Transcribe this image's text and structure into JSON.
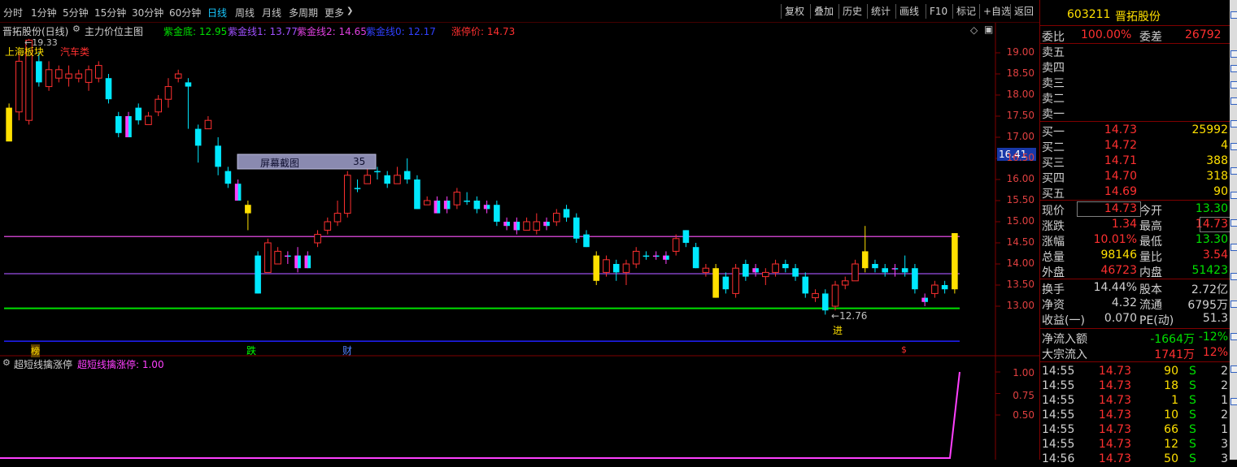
{
  "toolbar": {
    "tabs": [
      "分时",
      "1分钟",
      "5分钟",
      "15分钟",
      "30分钟",
      "60分钟",
      "日线",
      "周线",
      "月线",
      "多周期",
      "更多"
    ],
    "active_tab": "日线",
    "more_arrow": "❯",
    "right_buttons": [
      "复权",
      "叠加",
      "历史",
      "统计",
      "画线",
      "F10",
      "标记",
      "+自选",
      "返回"
    ]
  },
  "chart": {
    "title": "晋拓股份(日线)",
    "indicator_name": "主力价位主图",
    "legend": {
      "zj_di": "紫金底: 12.95",
      "zj1": "紫金线1: 13.77",
      "zj2": "紫金线2: 14.65",
      "zj0": "紫金线0: 12.17",
      "zt": "涨停价: 14.73"
    },
    "labels": {
      "sector": "上海板块",
      "industry": "汽车类",
      "high_mark": "19.33",
      "low_mark": "12.76",
      "jin": "进",
      "screenshot_box": "屏幕截图",
      "screenshot_num": "35",
      "current_price_tag": "16.41"
    },
    "events": [
      "榜",
      "跌",
      "财",
      "$"
    ],
    "price_axis": [
      "19.00",
      "18.50",
      "18.00",
      "17.50",
      "17.00",
      "16.50",
      "16.00",
      "15.50",
      "15.00",
      "14.50",
      "14.00",
      "13.50",
      "13.00"
    ],
    "sub": {
      "name": "超短线擒涨停",
      "value_label": "超短线擒涨停: 1.00",
      "axis": [
        "1.00",
        "0.75",
        "0.50"
      ]
    },
    "colors": {
      "up": "#ff3030",
      "down": "#00e8ff",
      "zj2": "#c040c0",
      "zj1": "#8040c0",
      "zjdi": "#00e000",
      "zj0": "#2020ff",
      "yellow": "#ffe000",
      "magenta": "#ff40ff"
    }
  },
  "chart_data": {
    "type": "candlestick",
    "ylim": [
      12.5,
      19.5
    ],
    "hlines": {
      "紫金线2": 14.65,
      "紫金线1": 13.77,
      "紫金底": 12.95,
      "紫金线0": 12.17
    },
    "candles": [
      [
        16.9,
        17.7,
        17.0,
        17.8,
        "y"
      ],
      [
        17.6,
        18.8,
        17.4,
        19.0,
        "u"
      ],
      [
        17.4,
        19.3,
        17.3,
        19.33,
        "u"
      ],
      [
        18.8,
        18.3,
        18.2,
        19.0,
        "d"
      ],
      [
        18.2,
        18.6,
        18.1,
        18.8,
        "u"
      ],
      [
        18.4,
        18.6,
        18.3,
        18.7,
        "u"
      ],
      [
        18.4,
        18.5,
        18.2,
        18.7,
        "u"
      ],
      [
        18.5,
        18.4,
        18.3,
        18.6,
        "u"
      ],
      [
        18.6,
        18.3,
        18.1,
        18.7,
        "u"
      ],
      [
        18.4,
        18.7,
        18.3,
        18.8,
        "u"
      ],
      [
        18.4,
        17.9,
        17.8,
        18.5,
        "d"
      ],
      [
        17.5,
        17.1,
        17.0,
        17.6,
        "d"
      ],
      [
        17.5,
        17.0,
        17.0,
        17.6,
        "m"
      ],
      [
        17.7,
        17.4,
        17.3,
        17.8,
        "d"
      ],
      [
        17.3,
        17.5,
        17.3,
        17.6,
        "u"
      ],
      [
        17.6,
        17.9,
        17.5,
        18.0,
        "u"
      ],
      [
        18.2,
        17.9,
        17.7,
        18.4,
        "u"
      ],
      [
        18.4,
        18.5,
        18.3,
        18.6,
        "u"
      ],
      [
        18.3,
        18.2,
        17.2,
        18.4,
        "d"
      ],
      [
        17.2,
        16.8,
        16.4,
        17.3,
        "d"
      ],
      [
        17.2,
        17.4,
        17.2,
        17.5,
        "u"
      ],
      [
        16.8,
        16.3,
        16.1,
        17.0,
        "d"
      ],
      [
        15.9,
        16.2,
        15.8,
        16.3,
        "d"
      ],
      [
        15.9,
        15.5,
        15.5,
        16.0,
        "m"
      ],
      [
        15.4,
        15.2,
        14.8,
        15.5,
        "y"
      ],
      [
        14.2,
        13.3,
        13.3,
        14.3,
        "d"
      ],
      [
        13.8,
        14.5,
        13.8,
        14.6,
        "u"
      ],
      [
        14.3,
        14.0,
        14.0,
        14.4,
        "u"
      ],
      [
        14.2,
        14.2,
        14.0,
        14.3,
        "m"
      ],
      [
        14.2,
        13.9,
        13.8,
        14.4,
        "m"
      ],
      [
        13.9,
        14.2,
        13.9,
        14.3,
        "m"
      ],
      [
        14.5,
        14.7,
        14.4,
        14.8,
        "u"
      ],
      [
        14.8,
        15.0,
        14.7,
        15.1,
        "u"
      ],
      [
        15.2,
        15.0,
        14.9,
        15.5,
        "u"
      ],
      [
        15.2,
        16.1,
        15.1,
        16.2,
        "u"
      ],
      [
        15.8,
        15.8,
        15.7,
        16.0,
        "d"
      ],
      [
        15.9,
        16.1,
        15.9,
        16.4,
        "u"
      ],
      [
        16.2,
        16.2,
        16.0,
        16.3,
        "d"
      ],
      [
        16.1,
        15.9,
        15.8,
        16.2,
        "d"
      ],
      [
        15.9,
        16.1,
        15.9,
        16.3,
        "u"
      ],
      [
        16.2,
        16.0,
        15.9,
        16.5,
        "d"
      ],
      [
        16.0,
        15.3,
        15.3,
        16.1,
        "d"
      ],
      [
        15.4,
        15.5,
        15.4,
        15.6,
        "u"
      ],
      [
        15.5,
        15.2,
        15.2,
        15.6,
        "m"
      ],
      [
        15.3,
        15.5,
        15.2,
        15.6,
        "m"
      ],
      [
        15.4,
        15.7,
        15.3,
        15.8,
        "u"
      ],
      [
        15.5,
        15.5,
        15.4,
        15.7,
        "d"
      ],
      [
        15.5,
        15.3,
        15.2,
        15.6,
        "d"
      ],
      [
        15.4,
        15.3,
        15.2,
        15.5,
        "m"
      ],
      [
        15.4,
        15.0,
        14.9,
        15.5,
        "d"
      ],
      [
        15.0,
        14.9,
        14.8,
        15.1,
        "m"
      ],
      [
        15.0,
        14.8,
        14.7,
        15.1,
        "m"
      ],
      [
        14.8,
        15.0,
        14.8,
        15.1,
        "u"
      ],
      [
        14.8,
        15.0,
        14.7,
        15.2,
        "u"
      ],
      [
        15.0,
        14.9,
        14.8,
        15.1,
        "m"
      ],
      [
        15.0,
        15.2,
        14.9,
        15.3,
        "u"
      ],
      [
        15.3,
        15.1,
        15.0,
        15.4,
        "d"
      ],
      [
        15.1,
        14.6,
        14.5,
        15.2,
        "d"
      ],
      [
        14.7,
        14.4,
        14.4,
        14.8,
        "d"
      ],
      [
        14.2,
        13.6,
        13.5,
        14.3,
        "y"
      ],
      [
        13.8,
        14.1,
        13.7,
        14.2,
        "u"
      ],
      [
        14.0,
        13.8,
        13.6,
        14.1,
        "d"
      ],
      [
        13.8,
        14.0,
        13.5,
        14.1,
        "u"
      ],
      [
        14.0,
        14.3,
        13.9,
        14.4,
        "u"
      ],
      [
        14.2,
        14.2,
        14.1,
        14.3,
        "d"
      ],
      [
        14.2,
        14.2,
        14.1,
        14.3,
        "m"
      ],
      [
        14.2,
        14.1,
        14.0,
        14.3,
        "m"
      ],
      [
        14.3,
        14.6,
        14.2,
        14.7,
        "u"
      ],
      [
        14.8,
        14.5,
        14.4,
        14.8,
        "d"
      ],
      [
        14.4,
        13.9,
        13.9,
        14.5,
        "d"
      ],
      [
        13.9,
        13.8,
        13.7,
        14.0,
        "u"
      ],
      [
        13.9,
        13.2,
        13.2,
        14.0,
        "y"
      ],
      [
        13.7,
        13.4,
        13.3,
        13.8,
        "d"
      ],
      [
        13.3,
        13.9,
        13.2,
        14.0,
        "u"
      ],
      [
        14.0,
        13.7,
        13.6,
        14.1,
        "d"
      ],
      [
        13.8,
        13.9,
        13.7,
        14.0,
        "m"
      ],
      [
        13.8,
        13.7,
        13.5,
        13.9,
        "u"
      ],
      [
        13.8,
        14.0,
        13.7,
        14.1,
        "u"
      ],
      [
        14.0,
        13.9,
        13.8,
        14.1,
        "d"
      ],
      [
        13.9,
        13.7,
        13.6,
        14.0,
        "d"
      ],
      [
        13.7,
        13.3,
        13.2,
        13.8,
        "d"
      ],
      [
        13.2,
        13.3,
        13.1,
        13.4,
        "u"
      ],
      [
        13.3,
        12.9,
        12.8,
        13.4,
        "d"
      ],
      [
        13.0,
        13.5,
        12.9,
        13.6,
        "u"
      ],
      [
        13.5,
        13.6,
        13.4,
        13.7,
        "u"
      ],
      [
        13.6,
        14.0,
        13.6,
        14.1,
        "u"
      ],
      [
        13.9,
        14.3,
        13.8,
        14.9,
        "y"
      ],
      [
        14.0,
        13.9,
        13.8,
        14.1,
        "d"
      ],
      [
        13.9,
        13.8,
        13.7,
        14.0,
        "d"
      ],
      [
        13.9,
        13.9,
        13.7,
        14.0,
        "m"
      ],
      [
        13.9,
        13.8,
        13.7,
        14.2,
        "d"
      ],
      [
        13.9,
        13.4,
        13.3,
        14.0,
        "d"
      ],
      [
        13.1,
        13.2,
        13.0,
        13.3,
        "m"
      ],
      [
        13.3,
        13.5,
        13.2,
        13.6,
        "u"
      ],
      [
        13.4,
        13.5,
        13.3,
        13.6,
        "d"
      ],
      [
        13.4,
        14.73,
        13.3,
        14.73,
        "y"
      ]
    ],
    "sub_series": {
      "name": "超短线擒涨停",
      "last": 1.0,
      "ylim": [
        0,
        1
      ]
    }
  },
  "panel": {
    "header": {
      "code": "603211",
      "name": "晋拓股份"
    },
    "weibi": {
      "l1": "委比",
      "v1": "100.00%",
      "l2": "委差",
      "v2": "26792"
    },
    "sells": [
      [
        "卖五",
        "",
        ""
      ],
      [
        "卖四",
        "",
        ""
      ],
      [
        "卖三",
        "",
        ""
      ],
      [
        "卖二",
        "",
        ""
      ],
      [
        "卖一",
        "",
        ""
      ]
    ],
    "buys": [
      [
        "买一",
        "14.73",
        "25992"
      ],
      [
        "买二",
        "14.72",
        "4"
      ],
      [
        "买三",
        "14.71",
        "388"
      ],
      [
        "买四",
        "14.70",
        "318"
      ],
      [
        "买五",
        "14.69",
        "90"
      ]
    ],
    "quotes": [
      [
        "现价",
        "14.73",
        "今开",
        "13.30"
      ],
      [
        "涨跌",
        "1.34",
        "最高",
        "14.73"
      ],
      [
        "涨幅",
        "10.01%",
        "最低",
        "13.30"
      ],
      [
        "总量",
        "98146",
        "量比",
        "3.54"
      ],
      [
        "外盘",
        "46723",
        "内盘",
        "51423"
      ]
    ],
    "stats": [
      [
        "换手",
        "14.44%",
        "股本",
        "2.72亿"
      ],
      [
        "净资",
        "4.32",
        "流通",
        "6795万"
      ],
      [
        "收益(一)",
        "0.070",
        "PE(动)",
        "51.3"
      ]
    ],
    "flow": [
      [
        "净流入额",
        "-1664万",
        "-12%"
      ],
      [
        "大宗流入",
        "1741万",
        "12%"
      ]
    ],
    "ticks": [
      [
        "14:55",
        "14.73",
        "90",
        "S",
        "2"
      ],
      [
        "14:55",
        "14.73",
        "18",
        "S",
        "2"
      ],
      [
        "14:55",
        "14.73",
        "1",
        "S",
        "1"
      ],
      [
        "14:55",
        "14.73",
        "10",
        "S",
        "2"
      ],
      [
        "14:55",
        "14.73",
        "66",
        "S",
        "1"
      ],
      [
        "14:55",
        "14.73",
        "12",
        "S",
        "3"
      ],
      [
        "14:56",
        "14.73",
        "50",
        "S",
        "3"
      ]
    ]
  }
}
